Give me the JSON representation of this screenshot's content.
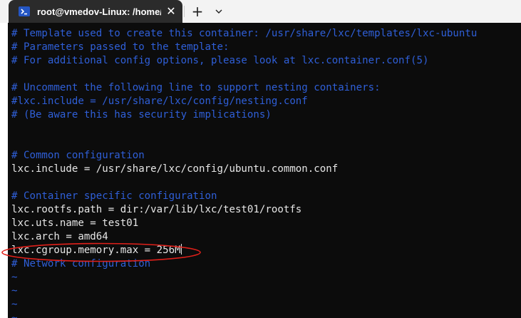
{
  "tab": {
    "title": "root@vmedov-Linux: /home/v",
    "close_symbol": "✕",
    "icon": "powershell-icon"
  },
  "new_tab_symbol": "+",
  "terminal": {
    "lines": [
      {
        "text": "# Template used to create this container: /usr/share/lxc/templates/lxc-ubuntu",
        "kind": "comment"
      },
      {
        "text": "# Parameters passed to the template:",
        "kind": "comment"
      },
      {
        "text": "# For additional config options, please look at lxc.container.conf(5)",
        "kind": "comment"
      },
      {
        "text": "",
        "kind": "code"
      },
      {
        "text": "# Uncomment the following line to support nesting containers:",
        "kind": "comment"
      },
      {
        "text": "#lxc.include = /usr/share/lxc/config/nesting.conf",
        "kind": "comment"
      },
      {
        "text": "# (Be aware this has security implications)",
        "kind": "comment"
      },
      {
        "text": "",
        "kind": "code"
      },
      {
        "text": "",
        "kind": "code"
      },
      {
        "text": "# Common configuration",
        "kind": "comment"
      },
      {
        "text": "lxc.include = /usr/share/lxc/config/ubuntu.common.conf",
        "kind": "code"
      },
      {
        "text": "",
        "kind": "code"
      },
      {
        "text": "# Container specific configuration",
        "kind": "comment"
      },
      {
        "text": "lxc.rootfs.path = dir:/var/lib/lxc/test01/rootfs",
        "kind": "code"
      },
      {
        "text": "lxc.uts.name = test01",
        "kind": "code"
      },
      {
        "text": "lxc.arch = amd64",
        "kind": "code"
      },
      {
        "text": "lxc.cgroup.memory.max = 256M",
        "kind": "code",
        "cursor": true
      },
      {
        "text": "# Network configuration",
        "kind": "comment"
      },
      {
        "text": "~",
        "kind": "tilde"
      },
      {
        "text": "~",
        "kind": "tilde"
      },
      {
        "text": "~",
        "kind": "tilde"
      },
      {
        "text": "~",
        "kind": "tilde"
      }
    ]
  },
  "colors": {
    "comment": "#2f5fd8",
    "code": "#e6e6e6",
    "background": "#0c0c0c",
    "annotation": "#e0201a"
  }
}
